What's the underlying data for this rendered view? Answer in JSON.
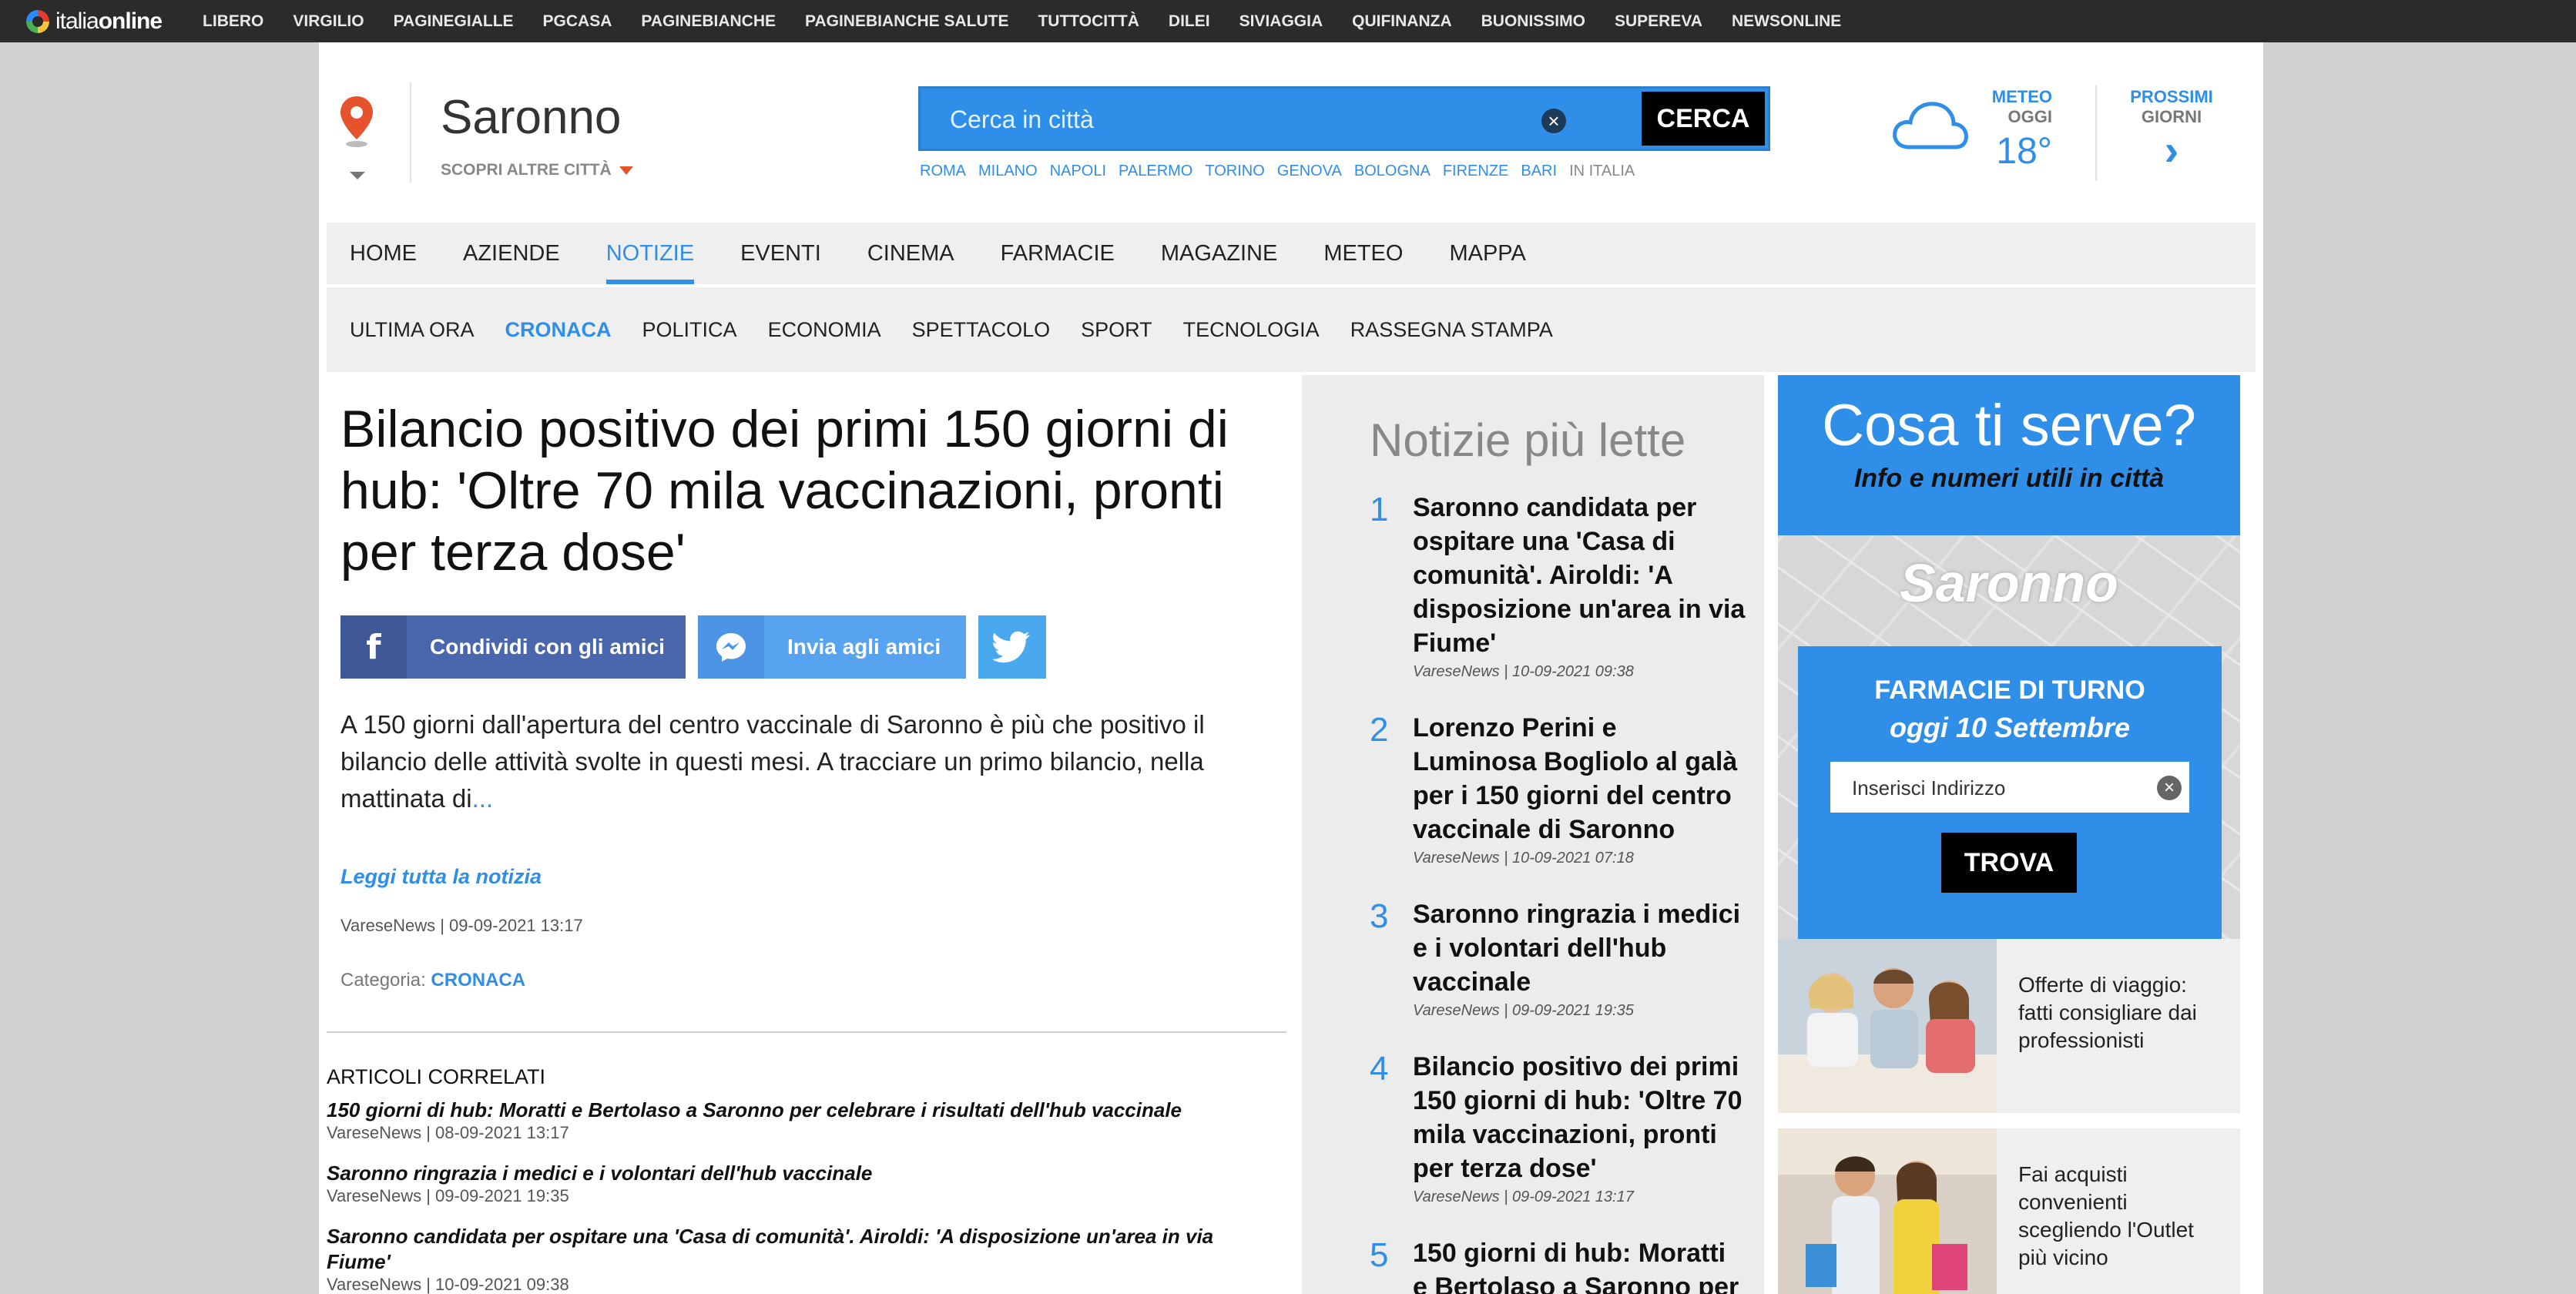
{
  "network": {
    "brand_a": "italia",
    "brand_b": "online",
    "links": [
      "LIBERO",
      "VIRGILIO",
      "PAGINEGIALLE",
      "PGCASA",
      "PAGINEBIANCHE",
      "PAGINEBIANCHE SALUTE",
      "TUTTOCITTÀ",
      "DILEI",
      "SIVIAGGIA",
      "QUIFINANZA",
      "BUONISSIMO",
      "SUPEREVA",
      "NEWSONLINE"
    ]
  },
  "header": {
    "city": "Saronno",
    "other_cities": "SCOPRI ALTRE CITTÀ",
    "search_placeholder": "Cerca in città",
    "search_button": "CERCA",
    "quick_cities": [
      "ROMA",
      "MILANO",
      "NAPOLI",
      "PALERMO",
      "TORINO",
      "GENOVA",
      "BOLOGNA",
      "FIRENZE",
      "BARI"
    ],
    "quick_last": "IN ITALIA",
    "weather": {
      "label": "METEO",
      "sub": "OGGI",
      "temp": "18°"
    },
    "next_days": {
      "label": "PROSSIMI",
      "sub": "GIORNI",
      "arrow": "›"
    }
  },
  "nav": {
    "main": [
      "HOME",
      "AZIENDE",
      "NOTIZIE",
      "EVENTI",
      "CINEMA",
      "FARMACIE",
      "MAGAZINE",
      "METEO",
      "MAPPA"
    ],
    "main_active": "NOTIZIE",
    "sub": [
      "ULTIMA ORA",
      "CRONACA",
      "POLITICA",
      "ECONOMIA",
      "SPETTACOLO",
      "SPORT",
      "TECNOLOGIA",
      "RASSEGNA STAMPA"
    ],
    "sub_active": "CRONACA"
  },
  "article": {
    "title": "Bilancio positivo dei primi 150 giorni di hub: 'Oltre 70 mila vaccinazioni, pronti per terza dose'",
    "share_fb": "Condividi con gli amici",
    "share_msg": "Invia agli amici",
    "lead": "A 150 giorni dall'apertura del centro vaccinale di Saronno è più che positivo il bilancio delle attività svolte in questi mesi. A tracciare un primo bilancio, nella mattinata di",
    "lead_more": "...",
    "read_more": "Leggi tutta la notizia",
    "meta": "VareseNews | 09-09-2021 13:17",
    "category_label": "Categoria:",
    "category": "CRONACA"
  },
  "related": {
    "title": "ARTICOLI CORRELATI",
    "items": [
      {
        "title": "150 giorni di hub: Moratti e Bertolaso a Saronno per celebrare i risultati dell'hub vaccinale",
        "meta": "VareseNews | 08-09-2021 13:17"
      },
      {
        "title": "Saronno ringrazia i medici e i volontari dell'hub vaccinale",
        "meta": "VareseNews | 09-09-2021 19:35"
      },
      {
        "title": "Saronno candidata per ospitare una 'Casa di comunità'. Airoldi: 'A disposizione un'area in via Fiume'",
        "meta": "VareseNews | 10-09-2021 09:38"
      }
    ]
  },
  "most_read": {
    "title": "Notizie più lette",
    "items": [
      {
        "num": "1",
        "title": "Saronno candidata per ospitare una 'Casa di comunità'. Airoldi: 'A disposizione un'area in via Fiume'",
        "meta": "VareseNews | 10-09-2021 09:38"
      },
      {
        "num": "2",
        "title": "Lorenzo Perini e Luminosa Bogliolo al galà per i 150 giorni del centro vaccinale di Saronno",
        "meta": "VareseNews | 10-09-2021 07:18"
      },
      {
        "num": "3",
        "title": "Saronno ringrazia i medici e i volontari dell'hub vaccinale",
        "meta": "VareseNews | 09-09-2021 19:35"
      },
      {
        "num": "4",
        "title": "Bilancio positivo dei primi 150 giorni di hub: 'Oltre 70 mila vaccinazioni, pronti per terza dose'",
        "meta": "VareseNews | 09-09-2021 13:17"
      },
      {
        "num": "5",
        "title": "150 giorni di hub: Moratti e Bertolaso a Saronno per",
        "meta": ""
      }
    ]
  },
  "sidebar": {
    "needs_title": "Cosa ti serve?",
    "needs_sub": "Info e numeri utili in città",
    "map_city": "Saronno",
    "pharmacy_title": "FARMACIE DI TURNO",
    "pharmacy_date": "oggi 10 Settembre",
    "address_placeholder": "Inserisci Indirizzo",
    "find_button": "TROVA",
    "promos": [
      {
        "text": "Offerte di viaggio: fatti consigliare dai professionisti"
      },
      {
        "text": "Fai acquisti convenienti scegliendo l'Outlet più vicino"
      }
    ]
  },
  "colors": {
    "accent": "#2f8ee8",
    "topbar": "#2b2b2b",
    "facebook": "#4a67ad",
    "messenger": "#57a3f0",
    "twitter": "#4aa8ef",
    "pin": "#e5532d"
  }
}
